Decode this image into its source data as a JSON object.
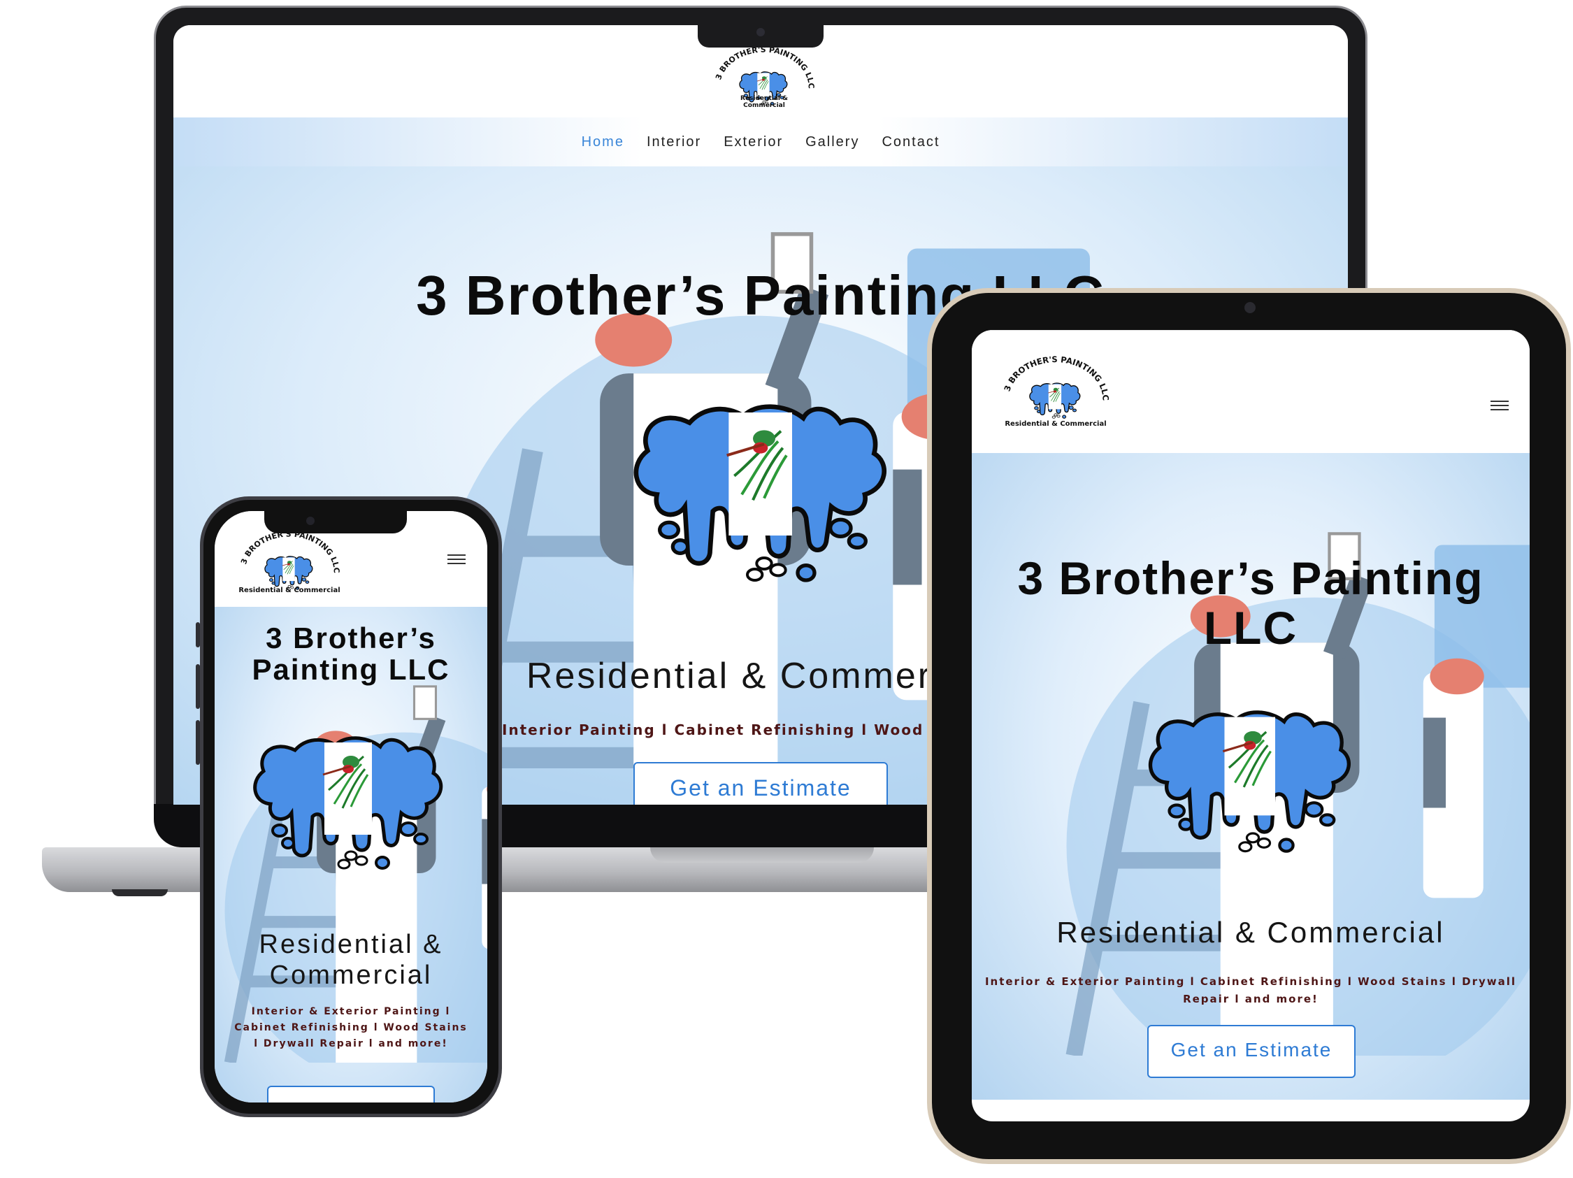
{
  "brand": {
    "logo_arc": "3 BROTHER'S PAINTING LLC",
    "logo_tagline": "Residential & Commercial"
  },
  "nav": {
    "items": [
      {
        "label": "Home",
        "active": true
      },
      {
        "label": "Interior",
        "active": false
      },
      {
        "label": "Exterior",
        "active": false
      },
      {
        "label": "Gallery",
        "active": false
      },
      {
        "label": "Contact",
        "active": false
      }
    ]
  },
  "desktop": {
    "title": "3 Brother’s Painting LLC",
    "subtitle": "Residential & Commercial",
    "services": "Interior Painting l Cabinet Refinishing l Wood Stains l D",
    "cta": "Get an Estimate"
  },
  "tablet": {
    "title": "3 Brother’s Painting LLC",
    "subtitle": "Residential & Commercial",
    "services": "Interior & Exterior Painting l Cabinet Refinishing l Wood Stains l Drywall Repair l and more!",
    "cta": "Get an Estimate"
  },
  "phone": {
    "title": "3 Brother’s Painting LLC",
    "subtitle": "Residential & Commercial",
    "services": "Interior & Exterior Painting l Cabinet Refinishing l Wood Stains l Drywall Repair l and more!",
    "cta": ""
  },
  "colors": {
    "accent_blue": "#3a86d8",
    "button_blue": "#2e7bd4",
    "logo_blue": "#4a8fe7",
    "services_text": "#4e1616"
  },
  "icons": {
    "menu": "hamburger-menu-icon",
    "logo": "quetzal-flag-logo-icon"
  }
}
